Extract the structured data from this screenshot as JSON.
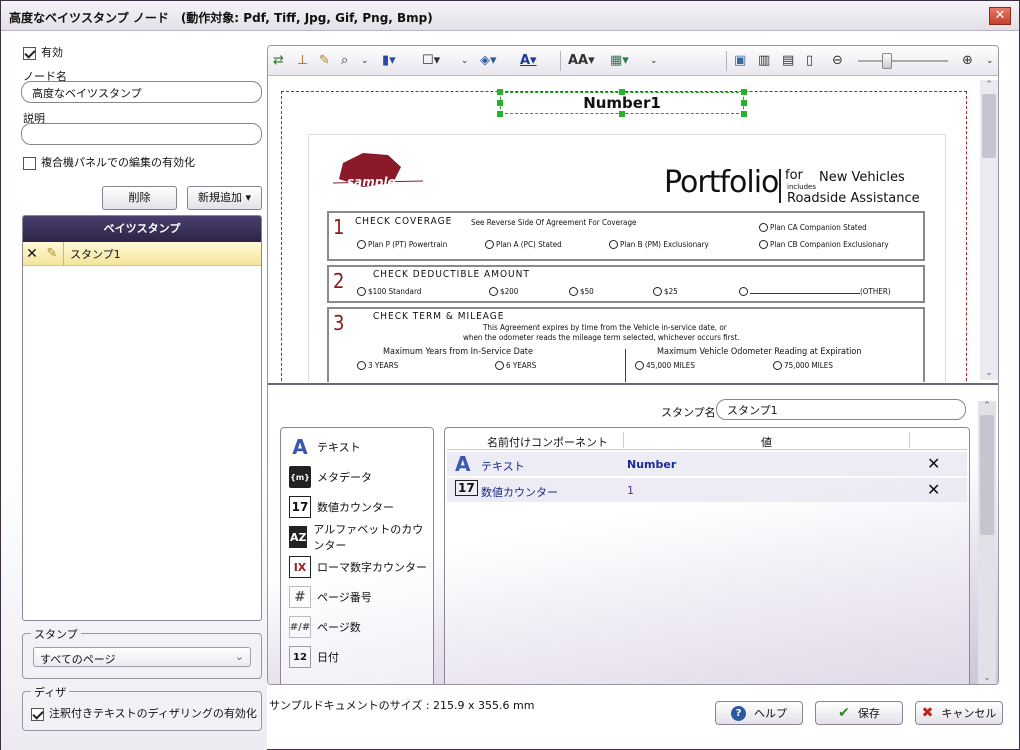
{
  "window": {
    "title": "高度なベイツスタンプ ノード　(動作対象: Pdf, Tiff, Jpg, Gif, Png, Bmp)"
  },
  "left": {
    "enabled_label": "有効",
    "node_name_label": "ノード名",
    "node_name_value": "高度なベイツスタンプ",
    "description_label": "説明",
    "description_value": "",
    "mfp_label": "複合機パネルでの編集の有効化",
    "delete_label": "削除",
    "add_new_label": "新規追加",
    "bates_panel_title": "ベイツスタンプ",
    "stamp_items": [
      {
        "name": "スタンプ1"
      }
    ],
    "stamp_group_label": "スタンプ",
    "stamp_pages_value": "すべてのページ",
    "dither_group_label": "ディザ",
    "dither_label": "注釈付きテキストのディザリングの有効化"
  },
  "preview": {
    "stamp_preview_text": "Number1",
    "doc": {
      "logo": "sample",
      "brand": "Portfolio",
      "for": "for",
      "includes": "includes",
      "new_vehicles": "New Vehicles",
      "roadside": "Roadside Assistance",
      "s1_num": "1",
      "s1_title": "CHECK COVERAGE",
      "s1_sub": "See Reverse Side Of Agreement For Coverage",
      "s1_opt1": "Plan P (PT) Powertrain",
      "s1_opt2": "Plan A (PC) Stated",
      "s1_opt3": "Plan B (PM) Exclusionary",
      "s1_opt4": "Plan CA Companion Stated",
      "s1_opt5": "Plan CB Companion Exclusionary",
      "s2_num": "2",
      "s2_title": "CHECK DEDUCTIBLE AMOUNT",
      "s2_opt1": "$100 Standard",
      "s2_opt2": "$200",
      "s2_opt3": "$50",
      "s2_opt4": "$25",
      "s2_opt5": "(OTHER)",
      "s3_num": "3",
      "s3_title": "CHECK TERM & MILEAGE",
      "s3_line1": "This Agreement expires by time from the Vehicle in-service date, or",
      "s3_line2": "when the odometer reads the mileage term selected, whichever occurs first.",
      "s3_h1": "Maximum Years from In-Service Date",
      "s3_h2": "Maximum Vehicle Odometer Reading at Expiration",
      "s3_opt1": "3 YEARS",
      "s3_opt2": "6 YEARS",
      "s3_opt3": "45,000 MILES",
      "s3_opt4": "75,000 MILES"
    }
  },
  "bottom": {
    "stamp_name_label": "スタンプ名",
    "stamp_name_value": "スタンプ1",
    "components": [
      {
        "icon": "text-icon",
        "label": "テキスト"
      },
      {
        "icon": "metadata-icon",
        "label": "メタデータ"
      },
      {
        "icon": "numeric-counter-icon",
        "label": "数値カウンター"
      },
      {
        "icon": "alpha-counter-icon",
        "label": "アルファベットのカウンター"
      },
      {
        "icon": "roman-counter-icon",
        "label": "ローマ数字カウンター"
      },
      {
        "icon": "page-number-icon",
        "label": "ページ番号"
      },
      {
        "icon": "page-count-icon",
        "label": "ページ数"
      },
      {
        "icon": "date-icon",
        "label": "日付"
      }
    ],
    "grid": {
      "col1": "名前付けコンポーネント",
      "col2": "値",
      "rows": [
        {
          "name": "テキスト",
          "value": "Number"
        },
        {
          "name": "数値カウンター",
          "value": "1"
        }
      ]
    }
  },
  "footer": {
    "doc_size": "サンプルドキュメントのサイズ : 215.9 x 355.6 mm",
    "help_label": "ヘルプ",
    "save_label": "保存",
    "cancel_label": "キャンセル"
  }
}
